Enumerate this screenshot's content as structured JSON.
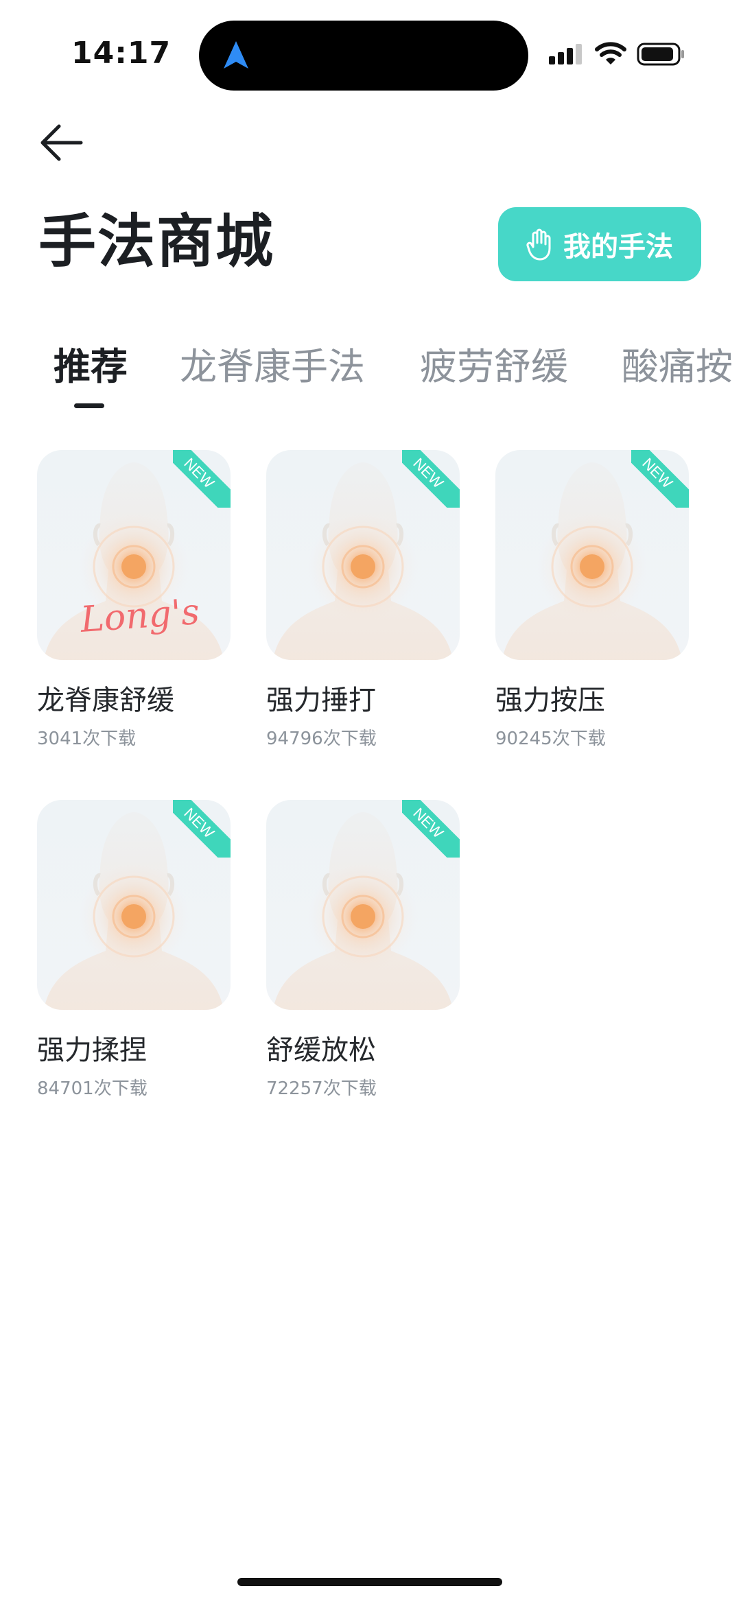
{
  "status_bar": {
    "time": "14:17"
  },
  "header": {
    "title": "手法商城",
    "my_button_label": "我的手法"
  },
  "tabs": [
    {
      "label": "推荐",
      "active": true
    },
    {
      "label": "龙脊康手法",
      "active": false
    },
    {
      "label": "疲劳舒缓",
      "active": false
    },
    {
      "label": "酸痛按",
      "active": false
    }
  ],
  "products": [
    {
      "title": "龙脊康舒缓",
      "downloads": "3041次下载",
      "badge": "NEW",
      "logo": "Long's"
    },
    {
      "title": "强力捶打",
      "downloads": "94796次下载",
      "badge": "NEW"
    },
    {
      "title": "强力按压",
      "downloads": "90245次下载",
      "badge": "NEW"
    },
    {
      "title": "强力揉捏",
      "downloads": "84701次下载",
      "badge": "NEW"
    },
    {
      "title": "舒缓放松",
      "downloads": "72257次下载",
      "badge": "NEW"
    }
  ],
  "colors": {
    "accent": "#47d7c8",
    "badge": "#3fd6bb",
    "logo": "#f16a6e"
  }
}
